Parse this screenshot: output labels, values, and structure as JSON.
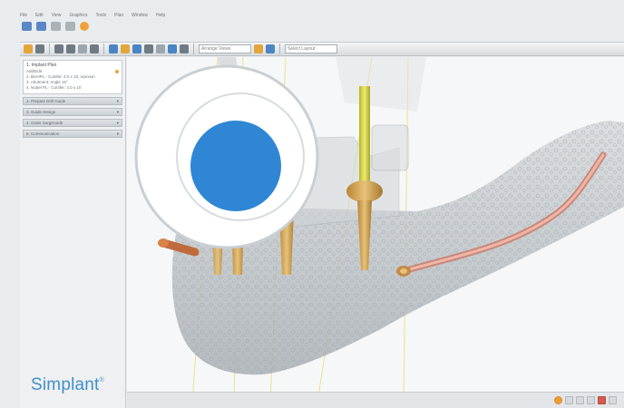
{
  "menu": [
    "File",
    "Edit",
    "View",
    "Graphics",
    "Tools",
    "Plan",
    "Window",
    "Help"
  ],
  "sidebar": {
    "active_step": {
      "title": "1. Implant Plan",
      "lines": [
        "Add/Edit",
        "2. BioHPL - Conifer: 4.0 x 10, Apexion",
        "3. Abutment: Angle 15°",
        "4. Nobel PL - Conifer: 4.0 x 10"
      ]
    },
    "steps": [
      "2. Prepare Drill Guide",
      "3. Guide Design",
      "4. Order SurgiGuide",
      "5. Communication"
    ]
  },
  "toolbar": {
    "select_value": "Arrange Views",
    "select_value_2": "Select Layout"
  },
  "brand": {
    "name": "Simplant",
    "mark": "®"
  },
  "colors": {
    "accent": "#3f8fc9",
    "implant_yellow": "#d8d43a",
    "implant_gold": "#d4a24e",
    "nerve": "#d9968a",
    "bone": "#b8bec2"
  }
}
